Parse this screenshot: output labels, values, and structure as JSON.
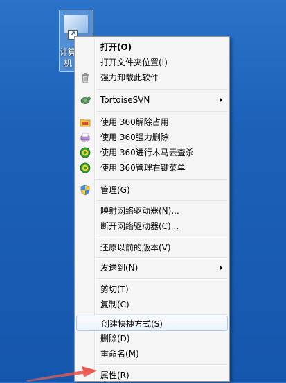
{
  "desktop": {
    "shortcut_label": "计算机",
    "background_color": "#1c60b8"
  },
  "menu": {
    "items": [
      {
        "label": "打开(O)",
        "icon": "none"
      },
      {
        "label": "打开文件夹位置(I)",
        "icon": "none"
      },
      {
        "label": "强力卸载此软件",
        "icon": "trash-icon"
      },
      {
        "label": "TortoiseSVN",
        "icon": "tortoise-svn-icon"
      },
      {
        "label": "使用 360解除占用",
        "icon": "folder-360-icon"
      },
      {
        "label": "使用 360强力删除",
        "icon": "shredder-360-icon"
      },
      {
        "label": "使用 360进行木马云查杀",
        "icon": "shield-360-icon"
      },
      {
        "label": "使用 360管理右键菜单",
        "icon": "shield-360-icon"
      },
      {
        "label": "管理(G)",
        "icon": "uac-shield-icon"
      },
      {
        "label": "映射网络驱动器(N)...",
        "icon": "none"
      },
      {
        "label": "断开网络驱动器(C)...",
        "icon": "none"
      },
      {
        "label": "还原以前的版本(V)",
        "icon": "none"
      },
      {
        "label": "发送到(N)",
        "icon": "none"
      },
      {
        "label": "剪切(T)",
        "icon": "none"
      },
      {
        "label": "复制(C)",
        "icon": "none"
      },
      {
        "label": "创建快捷方式(S)",
        "icon": "none"
      },
      {
        "label": "删除(D)",
        "icon": "none"
      },
      {
        "label": "重命名(M)",
        "icon": "none"
      },
      {
        "label": "属性(R)",
        "icon": "none"
      }
    ],
    "highlighted_item": "创建快捷方式(S)",
    "highlight_color": "#aeccef"
  },
  "annotation": {
    "arrow_color": "#e8453c"
  }
}
